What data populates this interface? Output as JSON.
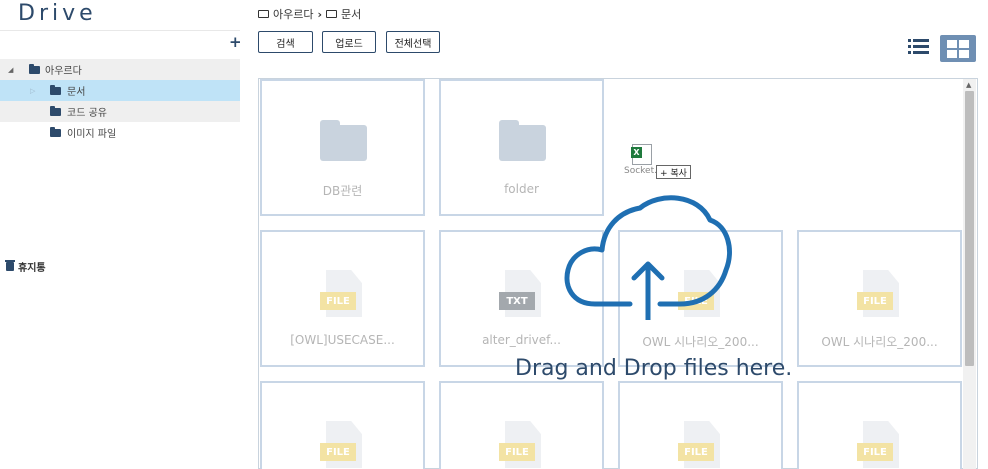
{
  "app": {
    "title": "Drive"
  },
  "sidebar": {
    "add_label": "+",
    "tree": [
      {
        "label": "아우르다",
        "caret": "◢"
      },
      {
        "label": "문서",
        "caret": "▷"
      },
      {
        "label": "코드 공유",
        "caret": ""
      },
      {
        "label": "이미지 파일",
        "caret": ""
      }
    ],
    "trash_label": "휴지통"
  },
  "breadcrumb": {
    "items": [
      "아우르다",
      "문서"
    ],
    "separator": "›"
  },
  "toolbar": {
    "search_label": "검색",
    "upload_label": "업로드",
    "select_all_label": "전체선택"
  },
  "files": [
    {
      "name": "DB관련",
      "type": "folder"
    },
    {
      "name": "folder",
      "type": "folder"
    },
    {
      "name": "[OWL]USECASE...",
      "type": "file",
      "badge": "FILE"
    },
    {
      "name": "alter_drivef...",
      "type": "file",
      "badge": "TXT"
    },
    {
      "name": "OWL 시나리오_200...",
      "type": "file",
      "badge": "FILE"
    },
    {
      "name": "OWL 시나리오_200...",
      "type": "file",
      "badge": "FILE"
    },
    {
      "name": "",
      "type": "file",
      "badge": "FILE"
    },
    {
      "name": "",
      "type": "file",
      "badge": "FILE"
    },
    {
      "name": "",
      "type": "file",
      "badge": "FILE"
    },
    {
      "name": "",
      "type": "file",
      "badge": "FILE"
    }
  ],
  "drag": {
    "ghost_name": "Socket.xl",
    "copy_label": "+ 복사",
    "drop_message": "Drag and Drop files here."
  },
  "colors": {
    "accent": "#2d4a6b",
    "selected": "#bfe3f7",
    "drop": "#1f6fb2"
  }
}
